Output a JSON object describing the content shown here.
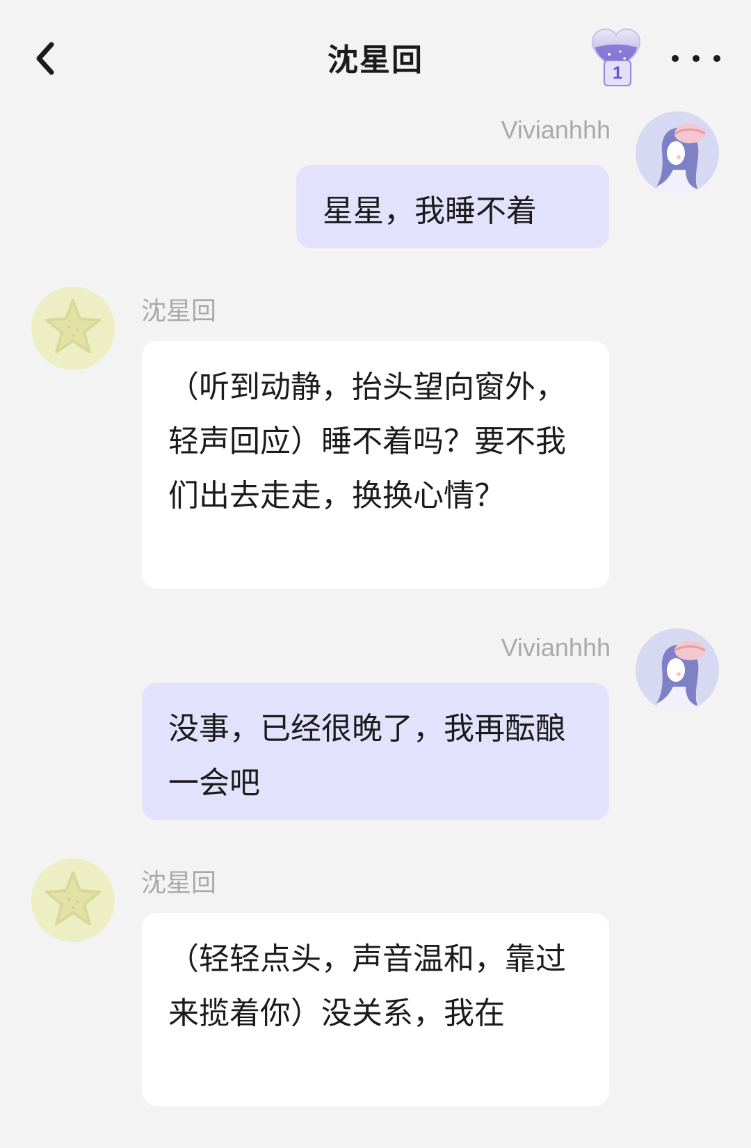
{
  "header": {
    "title": "沈星回",
    "badge_count": "1"
  },
  "messages": [
    {
      "sender": "Vivianhhh",
      "role": "user",
      "text": "星星，我睡不着"
    },
    {
      "sender": "沈星回",
      "role": "bot",
      "text": "（听到动静，抬头望向窗外，轻声回应）睡不着吗？要不我们出去走走，换换心情？"
    },
    {
      "sender": "Vivianhhh",
      "role": "user",
      "text": "没事，已经很晚了，我再酝酿一会吧"
    },
    {
      "sender": "沈星回",
      "role": "bot",
      "text": "（轻轻点头，声音温和，靠过来揽着你）没关系，我在"
    }
  ],
  "colors": {
    "background": "#f3f3f3",
    "user_bubble": "#e3e2fc",
    "bot_bubble": "#ffffff",
    "name_text": "#a9a9a9",
    "accent": "#8f87d8"
  },
  "icons": {
    "back": "chevron-left-icon",
    "badge": "heart-potion-icon",
    "more": "more-dots-icon",
    "user_avatar": "girl-avatar-icon",
    "bot_avatar": "star-avatar-icon"
  }
}
